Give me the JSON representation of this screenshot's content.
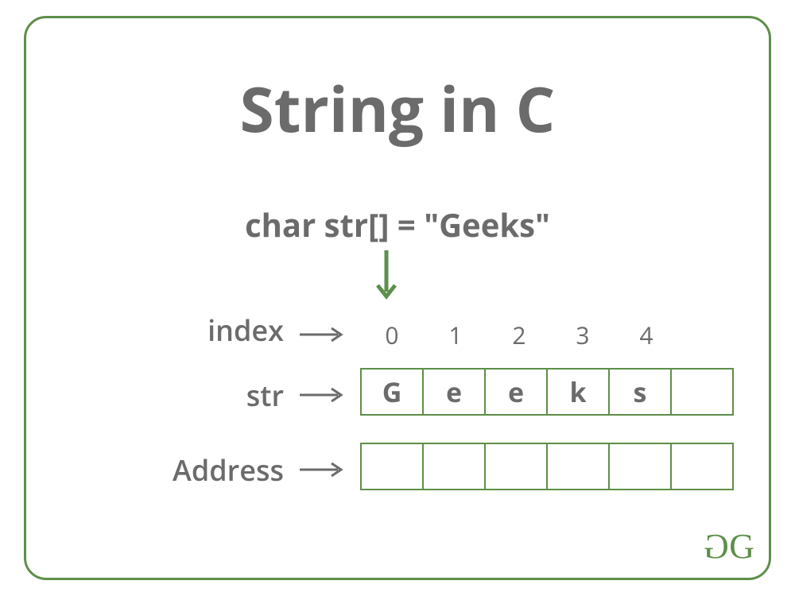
{
  "title": "String in C",
  "declaration": {
    "lhs": "char str[] = ",
    "rhs": "\"Geeks\""
  },
  "rows": {
    "index_label": "index",
    "str_label": "str",
    "addr_label": "Address"
  },
  "indices": [
    "0",
    "1",
    "2",
    "3",
    "4"
  ],
  "str_cells": [
    "G",
    "e",
    "e",
    "k",
    "s",
    ""
  ],
  "addr_cells": [
    "",
    "",
    "",
    "",
    "",
    ""
  ],
  "logo": "GG",
  "colors": {
    "border_green": "#5d8f4a",
    "text_gray": "#6b6b6b"
  }
}
